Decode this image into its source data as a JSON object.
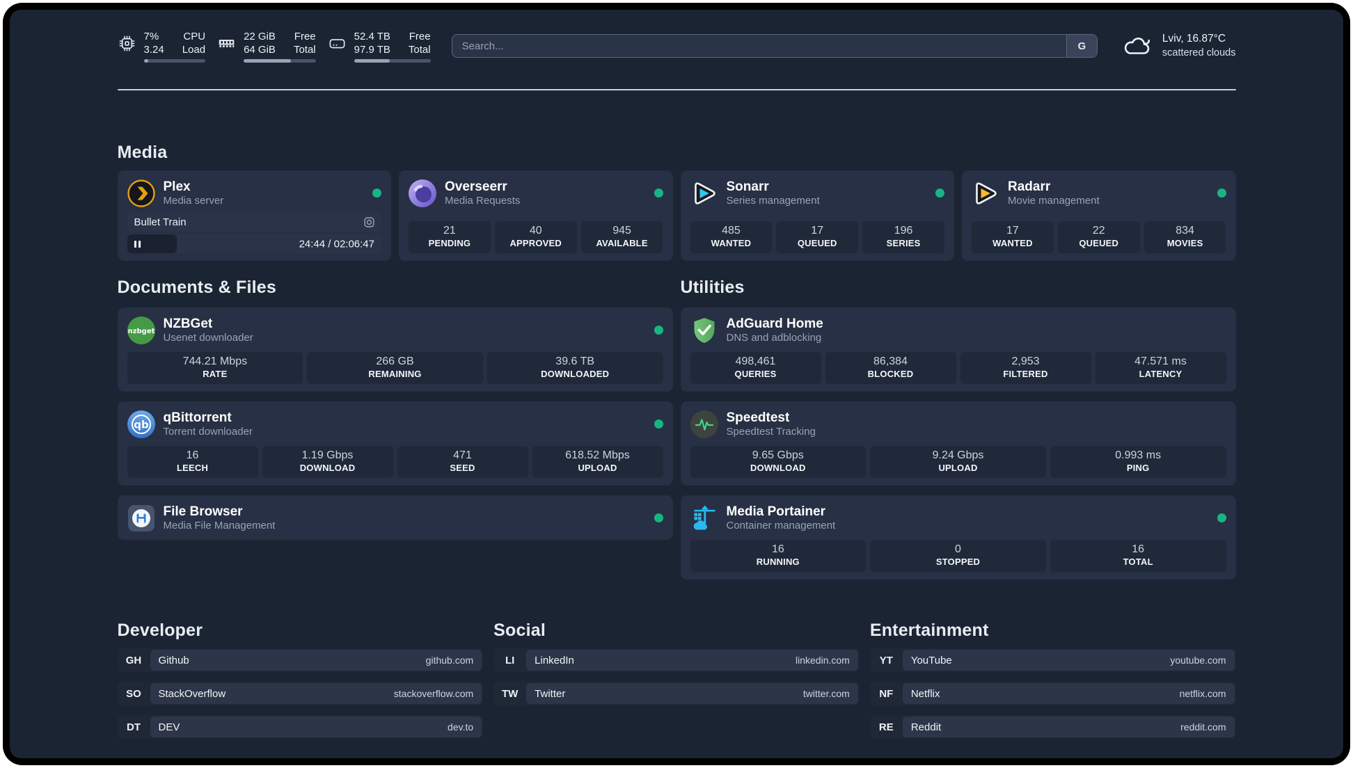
{
  "header": {
    "stats": [
      {
        "icon": "cpu-icon",
        "values": [
          "7%",
          "3.24"
        ],
        "labels": [
          "CPU",
          "Load"
        ],
        "progress": 7
      },
      {
        "icon": "ram-icon",
        "values": [
          "22 GiB",
          "64 GiB"
        ],
        "labels": [
          "Free",
          "Total"
        ],
        "progress": 66
      },
      {
        "icon": "disk-icon",
        "values": [
          "52.4 TB",
          "97.9 TB"
        ],
        "labels": [
          "Free",
          "Total"
        ],
        "progress": 47
      }
    ],
    "search": {
      "placeholder": "Search...",
      "engine": "G"
    },
    "weather": {
      "line1": "Lviv, 16.87°C",
      "line2": "scattered clouds"
    }
  },
  "media_section": {
    "title": "Media",
    "cards": [
      {
        "icon": "plex-icon",
        "name": "Plex",
        "description": "Media server",
        "status": "online",
        "player": {
          "track": "Bullet Train",
          "time": "24:44 / 02:06:47",
          "progress": 19.5,
          "state": "paused"
        }
      },
      {
        "icon": "overseerr-icon",
        "name": "Overseerr",
        "description": "Media Requests",
        "status": "online",
        "stats": [
          {
            "value": "21",
            "label": "PENDING"
          },
          {
            "value": "40",
            "label": "APPROVED"
          },
          {
            "value": "945",
            "label": "AVAILABLE"
          }
        ]
      },
      {
        "icon": "sonarr-icon",
        "name": "Sonarr",
        "description": "Series management",
        "status": "online",
        "stats": [
          {
            "value": "485",
            "label": "WANTED"
          },
          {
            "value": "17",
            "label": "QUEUED"
          },
          {
            "value": "196",
            "label": "SERIES"
          }
        ]
      },
      {
        "icon": "radarr-icon",
        "name": "Radarr",
        "description": "Movie management",
        "status": "online",
        "stats": [
          {
            "value": "17",
            "label": "WANTED"
          },
          {
            "value": "22",
            "label": "QUEUED"
          },
          {
            "value": "834",
            "label": "MOVIES"
          }
        ]
      }
    ]
  },
  "columns": [
    {
      "title": "Documents & Files",
      "cards": [
        {
          "icon": "nzbget-icon",
          "name": "NZBGet",
          "description": "Usenet downloader",
          "status": "online",
          "stats": [
            {
              "value": "744.21 Mbps",
              "label": "RATE"
            },
            {
              "value": "266 GB",
              "label": "REMAINING"
            },
            {
              "value": "39.6 TB",
              "label": "DOWNLOADED"
            }
          ]
        },
        {
          "icon": "qbittorrent-icon",
          "name": "qBittorrent",
          "description": "Torrent downloader",
          "status": "online",
          "stats": [
            {
              "value": "16",
              "label": "LEECH"
            },
            {
              "value": "1.19 Gbps",
              "label": "DOWNLOAD"
            },
            {
              "value": "471",
              "label": "SEED"
            },
            {
              "value": "618.52 Mbps",
              "label": "UPLOAD"
            }
          ]
        },
        {
          "icon": "filebrowser-icon",
          "name": "File Browser",
          "description": "Media File Management",
          "status": "online",
          "stats": []
        }
      ]
    },
    {
      "title": "Utilities",
      "cards": [
        {
          "icon": "adguard-icon",
          "name": "AdGuard Home",
          "description": "DNS and adblocking",
          "status": "unknown",
          "stats": [
            {
              "value": "498,461",
              "label": "QUERIES"
            },
            {
              "value": "86,384",
              "label": "BLOCKED"
            },
            {
              "value": "2,953",
              "label": "FILTERED"
            },
            {
              "value": "47.571 ms",
              "label": "LATENCY"
            }
          ]
        },
        {
          "icon": "speedtest-icon",
          "name": "Speedtest",
          "description": "Speedtest Tracking",
          "status": "unknown",
          "stats": [
            {
              "value": "9.65 Gbps",
              "label": "DOWNLOAD"
            },
            {
              "value": "9.24 Gbps",
              "label": "UPLOAD"
            },
            {
              "value": "0.993 ms",
              "label": "PING"
            }
          ]
        },
        {
          "icon": "portainer-icon",
          "name": "Media Portainer",
          "description": "Container management",
          "status": "online",
          "stats": [
            {
              "value": "16",
              "label": "RUNNING"
            },
            {
              "value": "0",
              "label": "STOPPED"
            },
            {
              "value": "16",
              "label": "TOTAL"
            }
          ]
        }
      ]
    }
  ],
  "link_sections": [
    {
      "title": "Developer",
      "links": [
        {
          "abbr": "GH",
          "name": "Github",
          "url": "github.com"
        },
        {
          "abbr": "SO",
          "name": "StackOverflow",
          "url": "stackoverflow.com"
        },
        {
          "abbr": "DT",
          "name": "DEV",
          "url": "dev.to"
        }
      ]
    },
    {
      "title": "Social",
      "links": [
        {
          "abbr": "LI",
          "name": "LinkedIn",
          "url": "linkedin.com"
        },
        {
          "abbr": "TW",
          "name": "Twitter",
          "url": "twitter.com"
        }
      ]
    },
    {
      "title": "Entertainment",
      "links": [
        {
          "abbr": "YT",
          "name": "YouTube",
          "url": "youtube.com"
        },
        {
          "abbr": "NF",
          "name": "Netflix",
          "url": "netflix.com"
        },
        {
          "abbr": "RE",
          "name": "Reddit",
          "url": "reddit.com"
        }
      ]
    }
  ],
  "colors": {
    "background": "#1b2433",
    "card": "#273044",
    "tile": "#1f2939",
    "status_online": "#17b583",
    "divider": "#c9d0d9",
    "text_primary": "#ffffff",
    "text_secondary": "#9aa4b3"
  }
}
